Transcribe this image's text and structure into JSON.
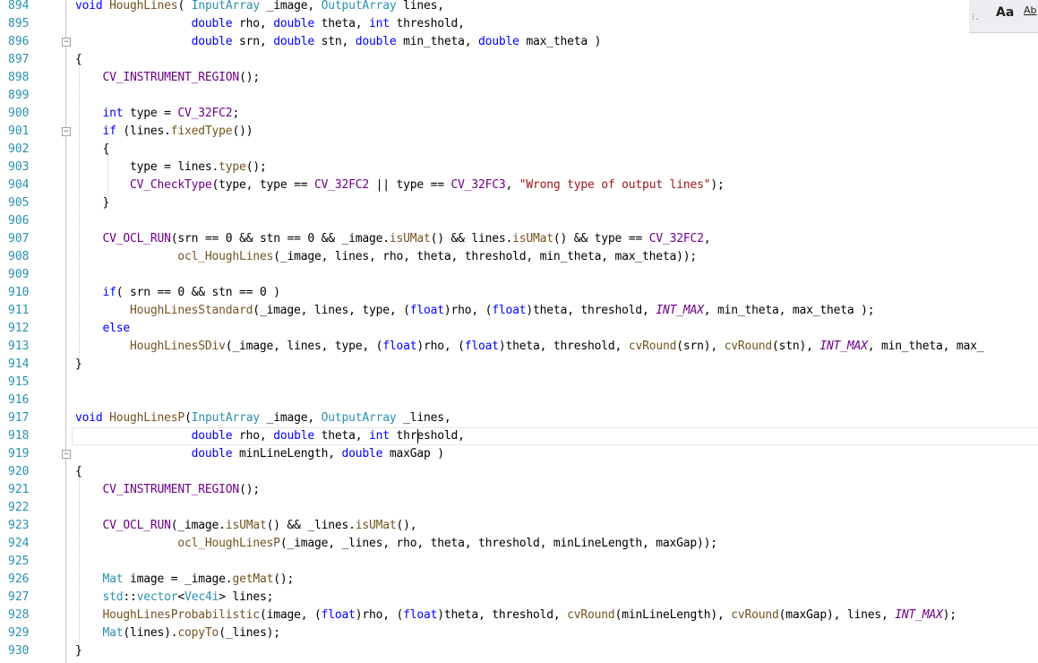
{
  "colors": {
    "keyword": "#0000ff",
    "type": "#2b91af",
    "function": "#74531f",
    "macro": "#6f008a",
    "string": "#a31515",
    "line_number": "#2b91af",
    "background": "#ffffff"
  },
  "find_bar": {
    "match_case": "Aa",
    "whole_word": "Ab"
  },
  "lines": [
    {
      "n": "894",
      "segs": [
        [
          "kw",
          "void"
        ],
        [
          "",
          " "
        ],
        [
          "fn",
          "HoughLines"
        ],
        [
          "",
          "( "
        ],
        [
          "ty",
          "InputArray"
        ],
        [
          "",
          " _image, "
        ],
        [
          "ty",
          "OutputArray"
        ],
        [
          "",
          " lines,"
        ]
      ]
    },
    {
      "n": "895",
      "segs": [
        [
          "",
          "                 "
        ],
        [
          "kw",
          "double"
        ],
        [
          "",
          " rho, "
        ],
        [
          "kw",
          "double"
        ],
        [
          "",
          " theta, "
        ],
        [
          "kw",
          "int"
        ],
        [
          "",
          " threshold,"
        ]
      ]
    },
    {
      "n": "896",
      "fold": true,
      "segs": [
        [
          "",
          "                 "
        ],
        [
          "kw",
          "double"
        ],
        [
          "",
          " srn, "
        ],
        [
          "kw",
          "double"
        ],
        [
          "",
          " stn, "
        ],
        [
          "kw",
          "double"
        ],
        [
          "",
          " min_theta, "
        ],
        [
          "kw",
          "double"
        ],
        [
          "",
          " max_theta )"
        ]
      ]
    },
    {
      "n": "897",
      "segs": [
        [
          "",
          "{"
        ]
      ]
    },
    {
      "n": "898",
      "segs": [
        [
          "",
          "    "
        ],
        [
          "mac",
          "CV_INSTRUMENT_REGION"
        ],
        [
          "",
          "();"
        ]
      ]
    },
    {
      "n": "899",
      "segs": []
    },
    {
      "n": "900",
      "segs": [
        [
          "",
          "    "
        ],
        [
          "kw",
          "int"
        ],
        [
          "",
          " type = "
        ],
        [
          "mac",
          "CV_32FC2"
        ],
        [
          "",
          ";"
        ]
      ]
    },
    {
      "n": "901",
      "fold": true,
      "segs": [
        [
          "",
          "    "
        ],
        [
          "kw",
          "if"
        ],
        [
          "",
          " (lines."
        ],
        [
          "fn",
          "fixedType"
        ],
        [
          "",
          "())"
        ]
      ]
    },
    {
      "n": "902",
      "segs": [
        [
          "",
          "    {"
        ]
      ]
    },
    {
      "n": "903",
      "segs": [
        [
          "",
          "        type = lines."
        ],
        [
          "fn",
          "type"
        ],
        [
          "",
          "();"
        ]
      ]
    },
    {
      "n": "904",
      "segs": [
        [
          "",
          "        "
        ],
        [
          "mac",
          "CV_CheckType"
        ],
        [
          "",
          "(type, type == "
        ],
        [
          "mac",
          "CV_32FC2"
        ],
        [
          "",
          " || type == "
        ],
        [
          "mac",
          "CV_32FC3"
        ],
        [
          "",
          ", "
        ],
        [
          "st",
          "\"Wrong type of output lines\""
        ],
        [
          "",
          ");"
        ]
      ]
    },
    {
      "n": "905",
      "segs": [
        [
          "",
          "    }"
        ]
      ]
    },
    {
      "n": "906",
      "segs": []
    },
    {
      "n": "907",
      "segs": [
        [
          "",
          "    "
        ],
        [
          "mac",
          "CV_OCL_RUN"
        ],
        [
          "",
          "(srn == 0 && stn == 0 && _image."
        ],
        [
          "fn",
          "isUMat"
        ],
        [
          "",
          "() && lines."
        ],
        [
          "fn",
          "isUMat"
        ],
        [
          "",
          "() && type == "
        ],
        [
          "mac",
          "CV_32FC2"
        ],
        [
          "",
          ","
        ]
      ]
    },
    {
      "n": "908",
      "segs": [
        [
          "",
          "               "
        ],
        [
          "fn",
          "ocl_HoughLines"
        ],
        [
          "",
          "(_image, lines, rho, theta, threshold, min_theta, max_theta));"
        ]
      ]
    },
    {
      "n": "909",
      "segs": []
    },
    {
      "n": "910",
      "segs": [
        [
          "",
          "    "
        ],
        [
          "kw",
          "if"
        ],
        [
          "",
          "( srn == 0 && stn == 0 )"
        ]
      ]
    },
    {
      "n": "911",
      "segs": [
        [
          "",
          "        "
        ],
        [
          "fn",
          "HoughLinesStandard"
        ],
        [
          "",
          "(_image, lines, type, ("
        ],
        [
          "kw",
          "float"
        ],
        [
          "",
          ")rho, ("
        ],
        [
          "kw",
          "float"
        ],
        [
          "",
          ")theta, threshold, "
        ],
        [
          "it",
          "INT_MAX"
        ],
        [
          "",
          ", min_theta, max_theta );"
        ]
      ]
    },
    {
      "n": "912",
      "segs": [
        [
          "",
          "    "
        ],
        [
          "kw",
          "else"
        ]
      ]
    },
    {
      "n": "913",
      "segs": [
        [
          "",
          "        "
        ],
        [
          "fn",
          "HoughLinesSDiv"
        ],
        [
          "",
          "(_image, lines, type, ("
        ],
        [
          "kw",
          "float"
        ],
        [
          "",
          ")rho, ("
        ],
        [
          "kw",
          "float"
        ],
        [
          "",
          ")theta, threshold, "
        ],
        [
          "fn",
          "cvRound"
        ],
        [
          "",
          "(srn), "
        ],
        [
          "fn",
          "cvRound"
        ],
        [
          "",
          "(stn), "
        ],
        [
          "it",
          "INT_MAX"
        ],
        [
          "",
          ", min_theta, max_"
        ]
      ]
    },
    {
      "n": "914",
      "segs": [
        [
          "",
          "}"
        ]
      ]
    },
    {
      "n": "915",
      "segs": []
    },
    {
      "n": "916",
      "segs": []
    },
    {
      "n": "917",
      "segs": [
        [
          "kw",
          "void"
        ],
        [
          "",
          " "
        ],
        [
          "fn",
          "HoughLinesP"
        ],
        [
          "",
          "("
        ],
        [
          "ty",
          "InputArray"
        ],
        [
          "",
          " _image, "
        ],
        [
          "ty",
          "OutputArray"
        ],
        [
          "",
          " _lines,"
        ]
      ]
    },
    {
      "n": "918",
      "current": true,
      "segs": [
        [
          "",
          "                 "
        ],
        [
          "kw",
          "double"
        ],
        [
          "",
          " rho, "
        ],
        [
          "kw",
          "double"
        ],
        [
          "",
          " theta, "
        ],
        [
          "kw",
          "int"
        ],
        [
          "",
          " threshold,"
        ]
      ]
    },
    {
      "n": "919",
      "fold": true,
      "segs": [
        [
          "",
          "                 "
        ],
        [
          "kw",
          "double"
        ],
        [
          "",
          " minLineLength, "
        ],
        [
          "kw",
          "double"
        ],
        [
          "",
          " maxGap )"
        ]
      ]
    },
    {
      "n": "920",
      "segs": [
        [
          "",
          "{"
        ]
      ]
    },
    {
      "n": "921",
      "segs": [
        [
          "",
          "    "
        ],
        [
          "mac",
          "CV_INSTRUMENT_REGION"
        ],
        [
          "",
          "();"
        ]
      ]
    },
    {
      "n": "922",
      "segs": []
    },
    {
      "n": "923",
      "segs": [
        [
          "",
          "    "
        ],
        [
          "mac",
          "CV_OCL_RUN"
        ],
        [
          "",
          "(_image."
        ],
        [
          "fn",
          "isUMat"
        ],
        [
          "",
          "() && _lines."
        ],
        [
          "fn",
          "isUMat"
        ],
        [
          "",
          "(),"
        ]
      ]
    },
    {
      "n": "924",
      "segs": [
        [
          "",
          "               "
        ],
        [
          "fn",
          "ocl_HoughLinesP"
        ],
        [
          "",
          "(_image, _lines, rho, theta, threshold, minLineLength, maxGap));"
        ]
      ]
    },
    {
      "n": "925",
      "segs": []
    },
    {
      "n": "926",
      "segs": [
        [
          "",
          "    "
        ],
        [
          "ty",
          "Mat"
        ],
        [
          "",
          " image = _image."
        ],
        [
          "fn",
          "getMat"
        ],
        [
          "",
          "();"
        ]
      ]
    },
    {
      "n": "927",
      "segs": [
        [
          "",
          "    "
        ],
        [
          "ty",
          "std"
        ],
        [
          "",
          "::"
        ],
        [
          "ty",
          "vector"
        ],
        [
          "",
          "<"
        ],
        [
          "ty",
          "Vec4i"
        ],
        [
          "",
          "> lines;"
        ]
      ]
    },
    {
      "n": "928",
      "segs": [
        [
          "",
          "    "
        ],
        [
          "fn",
          "HoughLinesProbabilistic"
        ],
        [
          "",
          "(image, ("
        ],
        [
          "kw",
          "float"
        ],
        [
          "",
          ")rho, ("
        ],
        [
          "kw",
          "float"
        ],
        [
          "",
          ")theta, threshold, "
        ],
        [
          "fn",
          "cvRound"
        ],
        [
          "",
          "(minLineLength), "
        ],
        [
          "fn",
          "cvRound"
        ],
        [
          "",
          "(maxGap), lines, "
        ],
        [
          "it",
          "INT_MAX"
        ],
        [
          "",
          ");"
        ]
      ]
    },
    {
      "n": "929",
      "segs": [
        [
          "",
          "    "
        ],
        [
          "ty",
          "Mat"
        ],
        [
          "",
          "(lines)."
        ],
        [
          "fn",
          "copyTo"
        ],
        [
          "",
          "(_lines);"
        ]
      ]
    },
    {
      "n": "930",
      "segs": [
        [
          "",
          "}"
        ]
      ]
    }
  ]
}
